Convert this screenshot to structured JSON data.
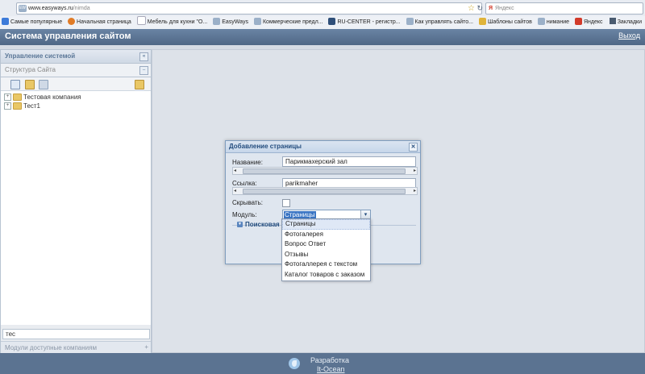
{
  "browser": {
    "url_host": "www.easyways.ru",
    "url_path": "/nimda",
    "url_badge": "EW",
    "search_placeholder": "Яндекс",
    "bookmarks": [
      {
        "label": "Самые популярные",
        "color": "#3d7bd9"
      },
      {
        "label": "Начальная страница",
        "color": "#e07b26"
      },
      {
        "label": "Мебель для кухни \"О...",
        "color": "#c0c6cf"
      },
      {
        "label": "EasyWays",
        "color": "#9bb0c8"
      },
      {
        "label": "Коммерческие предл...",
        "color": "#9bb0c8"
      },
      {
        "label": "RU-CENTER - регистр...",
        "color": "#2f4f79"
      },
      {
        "label": "Как управлять сайто...",
        "color": "#9bb0c8"
      },
      {
        "label": "Шаблоны сайтов",
        "color": "#e0b43a"
      },
      {
        "label": "нимание",
        "color": "#9bb0c8"
      },
      {
        "label": "Яндекс",
        "color": "#d23a2a"
      }
    ],
    "bookmarks_menu": "Закладки"
  },
  "header": {
    "title": "Система управления сайтом",
    "logout": "Выход"
  },
  "left_panel": {
    "title": "Управление системой",
    "tree_title": "Структура Сайта",
    "tree_items": [
      {
        "label": "Тестовая компания"
      },
      {
        "label": "Тест1"
      }
    ],
    "filter_value": "тес",
    "modules_title": "Модули доступные компаниям"
  },
  "dialog": {
    "title": "Добавление страницы",
    "name_label": "Название:",
    "name_value": "Парикмахерский зал",
    "link_label": "Ссылка:",
    "link_value": "parikmaher",
    "hide_label": "Скрывать:",
    "module_label": "Модуль:",
    "module_value": "Страницы",
    "search_section": "Поисковая оп"
  },
  "dropdown_options": [
    "Страницы",
    "Фотогалерея",
    "Вопрос Ответ",
    "Отзывы",
    "Фотогаллерея с текстом",
    "Каталог товаров с заказом"
  ],
  "footer": {
    "dev_label": "Разработка",
    "dev_link": "It-Ocean"
  }
}
